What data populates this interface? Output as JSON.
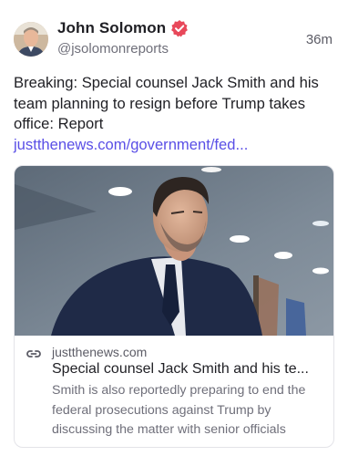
{
  "author": {
    "display_name": "John Solomon",
    "handle": "@jsolomonreports",
    "timestamp": "36m",
    "verified_color": "#e8485a"
  },
  "post": {
    "text": "Breaking: Special counsel Jack Smith and his team planning to resign before Trump takes office: Report ",
    "link_text": "justthenews.com/government/fed...",
    "link_color": "#5a4fe6"
  },
  "link_card": {
    "domain": "justthenews.com",
    "title": "Special counsel Jack Smith and his te...",
    "description": "Smith is also reportedly preparing to end the federal prosecutions against Trump by discussing the matter with senior officials",
    "icons": [
      "link-icon"
    ]
  }
}
